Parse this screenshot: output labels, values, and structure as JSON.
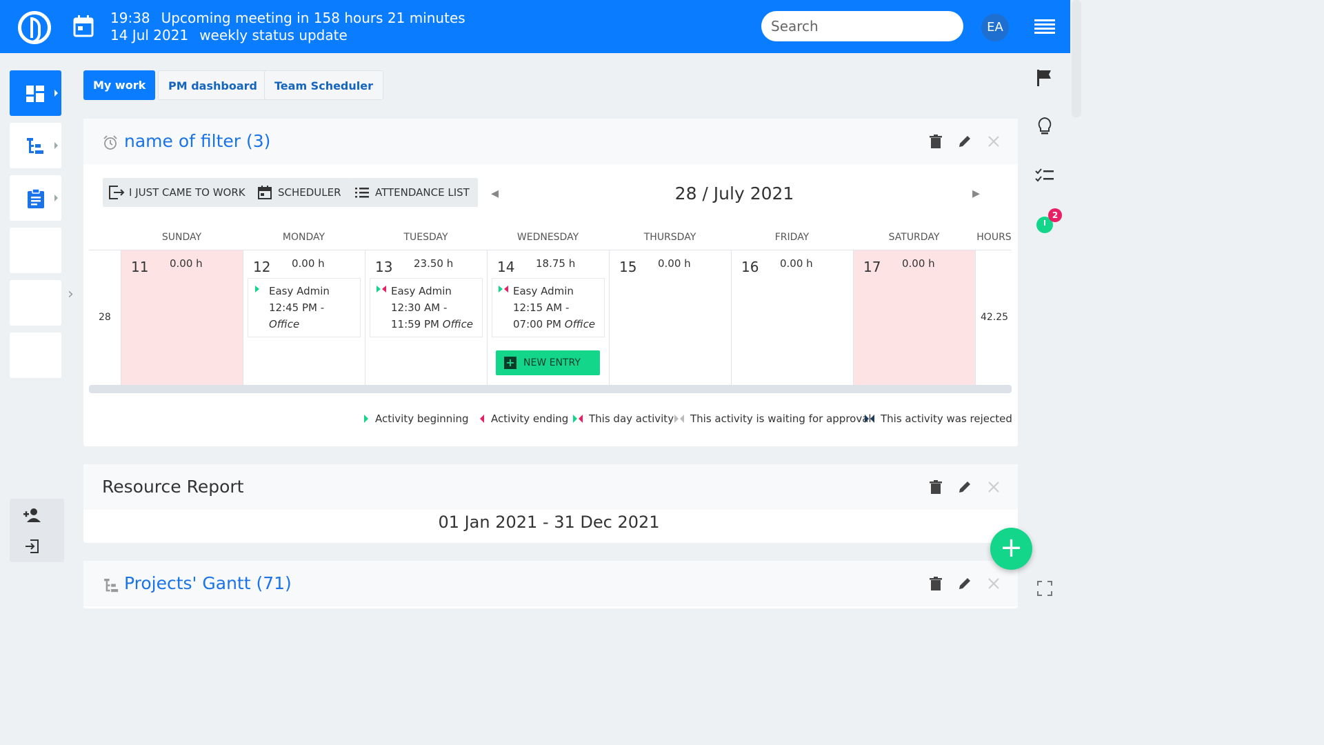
{
  "header": {
    "meeting_time": "19:38",
    "meeting_text": "Upcoming meeting in 158 hours 21 minutes",
    "meeting_date": "14 Jul 2021",
    "meeting_title": "weekly status update",
    "search_placeholder": "Search",
    "avatar_initials": "EA"
  },
  "tabs": [
    {
      "label": "My work",
      "active": true
    },
    {
      "label": "PM dashboard",
      "active": false
    },
    {
      "label": "Team Scheduler",
      "active": false
    }
  ],
  "attendance_card": {
    "title": "name of filter (3)",
    "toolbar": {
      "came_to_work": "I JUST CAME TO WORK",
      "scheduler": "SCHEDULER",
      "attendance_list": "ATTENDANCE LIST"
    },
    "month_title": "28 / July 2021",
    "day_headers": [
      "SUNDAY",
      "MONDAY",
      "TUESDAY",
      "WEDNESDAY",
      "THURSDAY",
      "FRIDAY",
      "SATURDAY"
    ],
    "hours_header": "HOURS",
    "week_number": "28",
    "week_total": "42.25",
    "days": [
      {
        "num": "11",
        "hours": "0.00 h"
      },
      {
        "num": "12",
        "hours": "0.00 h"
      },
      {
        "num": "13",
        "hours": "23.50 h"
      },
      {
        "num": "14",
        "hours": "18.75 h"
      },
      {
        "num": "15",
        "hours": "0.00 h"
      },
      {
        "num": "16",
        "hours": "0.00 h"
      },
      {
        "num": "17",
        "hours": "0.00 h"
      }
    ],
    "entries": {
      "mon": {
        "who": "Easy Admin",
        "time": "12:45 PM - ",
        "place": "Office"
      },
      "tue": {
        "who": "Easy Admin",
        "time": "12:30 AM - 11:59 PM",
        "place": "Office"
      },
      "wed": {
        "who": "Easy Admin",
        "time": "12:15 AM - 07:00 PM",
        "place": "Office"
      }
    },
    "new_entry_label": "NEW ENTRY",
    "legend": {
      "beginning": "Activity beginning",
      "ending": "Activity ending",
      "day": "This day activity",
      "waiting": "This activity is waiting for approval",
      "rejected": "This activity was rejected"
    }
  },
  "resource_card": {
    "title": "Resource Report",
    "date_range": "01 Jan 2021 - 31 Dec 2021"
  },
  "gantt_card": {
    "title": "Projects' Gantt (71)"
  },
  "fab_label": "+",
  "colors": {
    "primary": "#0a7cff",
    "accent_green": "#13d68a",
    "weekend": "#fde3e3",
    "badge": "#e91e63",
    "marker_pink": "#e91e63"
  },
  "badge_count": "2"
}
